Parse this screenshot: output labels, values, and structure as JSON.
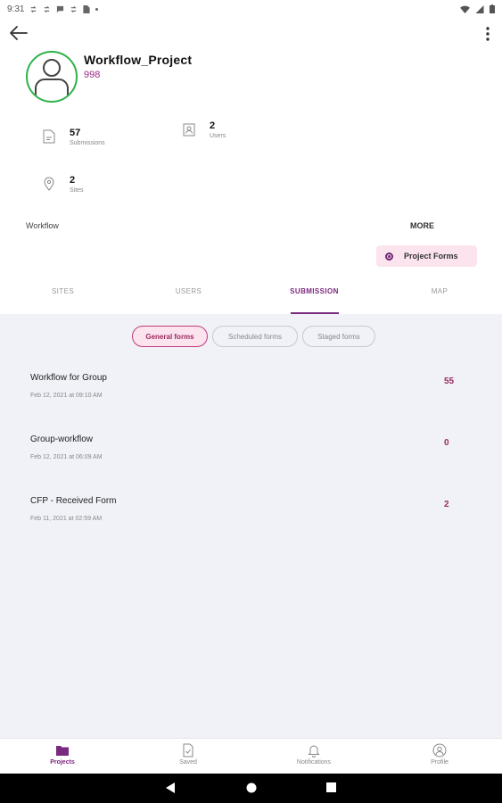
{
  "status_bar": {
    "time": "9:31",
    "icons_left": [
      "sync-icon",
      "sync-icon",
      "message-icon",
      "sync-icon",
      "sim-icon",
      "dot-icon"
    ],
    "icons_right": [
      "wifi-icon",
      "signal-icon",
      "battery-icon"
    ]
  },
  "toolbar": {
    "back_icon": "arrow-back-icon",
    "menu_icon": "more-vert-icon"
  },
  "project": {
    "name": "Workflow_Project",
    "id": "998"
  },
  "stats": [
    {
      "value": "57",
      "label": "Submissions",
      "icon": "document-icon"
    },
    {
      "value": "2",
      "label": "Users",
      "icon": "user-card-icon"
    },
    {
      "value": "2",
      "label": "Sites",
      "icon": "location-pin-icon"
    }
  ],
  "workflow_label": "Workflow",
  "more_label": "MORE",
  "project_forms_label": "Project Forms",
  "tabs": [
    {
      "label": "SITES",
      "active": false
    },
    {
      "label": "USERS",
      "active": false
    },
    {
      "label": "SUBMISSION",
      "active": true
    },
    {
      "label": "MAP",
      "active": false
    }
  ],
  "filters": [
    {
      "label": "General forms",
      "active": true
    },
    {
      "label": "Scheduled forms",
      "active": false
    },
    {
      "label": "Staged forms",
      "active": false
    }
  ],
  "forms": [
    {
      "title": "Workflow for Group",
      "date": "Feb 12, 2021 at 09:10 AM",
      "count": "55"
    },
    {
      "title": "Group-workflow",
      "date": "Feb 12, 2021 at 06:09 AM",
      "count": "0"
    },
    {
      "title": "CFP - Received Form",
      "date": "Feb 11, 2021 at 02:59 AM",
      "count": "2"
    }
  ],
  "bottom_nav": [
    {
      "label": "Projects",
      "icon": "folder-icon",
      "active": true
    },
    {
      "label": "Saved",
      "icon": "saved-doc-icon",
      "active": false
    },
    {
      "label": "Notifications",
      "icon": "bell-icon",
      "active": false
    },
    {
      "label": "Profile",
      "icon": "profile-icon",
      "active": false
    }
  ],
  "colors": {
    "accent": "#7a2a7e",
    "accent_light": "#fbe4ee",
    "avatar_ring": "#2eb24a",
    "count": "#9c2b60",
    "content_bg": "#f0f2f7"
  }
}
